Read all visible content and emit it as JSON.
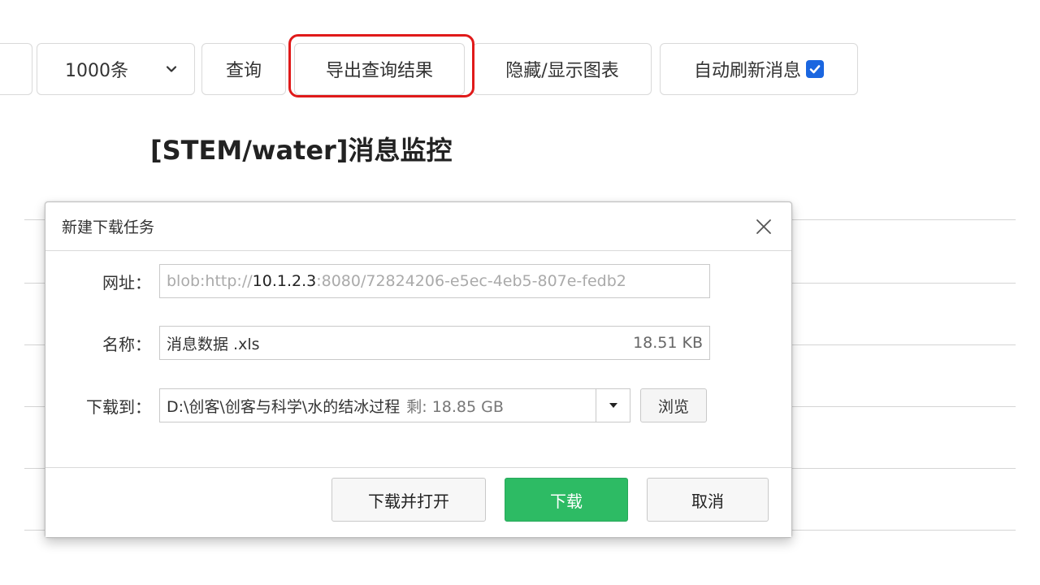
{
  "toolbar": {
    "limit_value": "1000条",
    "query_label": "查询",
    "export_label": "导出查询结果",
    "toggle_chart_label": "隐藏/显示图表",
    "auto_refresh_label": "自动刷新消息",
    "auto_refresh_checked": true
  },
  "page": {
    "title": "[STEM/water]消息监控"
  },
  "dialog": {
    "title": "新建下载任务",
    "url_label": "网址：",
    "url_prefix": "blob:http://",
    "url_host": "10.1.2.3",
    "url_rest": ":8080/72824206-e5ec-4eb5-807e-fedb2",
    "name_label": "名称：",
    "name_value": "消息数据 .xls",
    "name_size": "18.51 KB",
    "save_label": "下载到：",
    "save_path": "D:\\创客\\创客与科学\\水的结冰过程",
    "free_space": "剩: 18.85 GB",
    "browse_label": "浏览",
    "download_open_label": "下载并打开",
    "download_label": "下载",
    "cancel_label": "取消"
  },
  "colors": {
    "highlight": "#e01a1a",
    "download_button": "#2dbb64",
    "checkbox": "#1a66e0"
  }
}
